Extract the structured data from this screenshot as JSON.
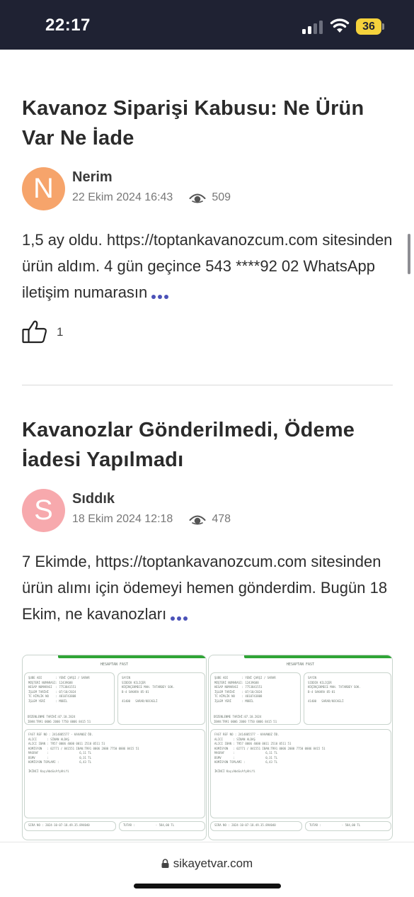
{
  "status_bar": {
    "time": "22:17",
    "battery": "36",
    "colors": {
      "background": "#1f2233",
      "battery": "#f5d23c"
    }
  },
  "posts": [
    {
      "title": "Kavanoz Siparişi Kabusu: Ne Ürün Var Ne İade",
      "avatar_letter": "N",
      "avatar_color": "#f6a46b",
      "author": "Nerim",
      "date": "22 Ekim 2024 16:43",
      "views": "509",
      "body": "1,5 ay oldu. https://toptankavanozcum.com sitesinden ürün aldım. 4 gün geçince 543 ****92 02 WhatsApp iletişim numarasın",
      "likes": "1"
    },
    {
      "title": "Kavanozlar Gönderilmedi, Ödeme İadesi Yapılmadı",
      "avatar_letter": "S",
      "avatar_color": "#f7a9ad",
      "author": "Sıddık",
      "date": "18 Ekim 2024 12:18",
      "views": "478",
      "body": "7 Ekimde, https://toptankavanozcum.com sitesinden ürün alımı için ödemeyi hemen gönderdim. Bugün 18 Ekim, ne kavanozları"
    }
  ],
  "receipt": {
    "header": "HESAPTAN FAST",
    "sender_block": "ŞUBE ADI        : YENİ ÇARŞI / SARAR\nMÜŞTERİ NUMARASI: 12439688\nHESAP NUMARASI  : 7753841551\nİŞLEM TARİHİ    : 07/10/2024\nTC KİMLİK NO    : 4810743808\nİŞLEM YERİ      : MOBİL",
    "receiver_block": "SAYIN\nSIDDIK KILIÇER\nKÜÇÜKÇEKMECE MAH. TATARBEY SOK.\nB-4 SAKARA 85-81\n\n41400   SARAR/KOCAELİ",
    "extra_block": "DÜZENLENME TARİHİ:07.10.2024\nIBAN:TR91 0006 2000 7750 0006 8415 51",
    "transfer_block": "FAST REF NO : 2414885577 - KAVANOZ ÖD.\nALICI      : SİNAN ALDAŞ\nALICI IBAN : TR57 0006 4000 0011 2510 0511 51\nKOMİSYON   : 02771 / 841551 IBAN:TR91 0006 2000 7750 0006 8415 51\nMASRAF     :                  6,11 TL\nBSMV       :                  0,31 TL\nKOMİSYON TOPLAMI :            6,43 TL",
    "note_block": "İKİNCİ KaşıAbdüsAfşAhifi",
    "footer_left": "SIRA NO : 2024-10-07-18.49.35.894040",
    "footer_right": "TUTAR :            - 584,00 TL"
  },
  "bottom_bar": {
    "url": "sikayetvar.com"
  }
}
